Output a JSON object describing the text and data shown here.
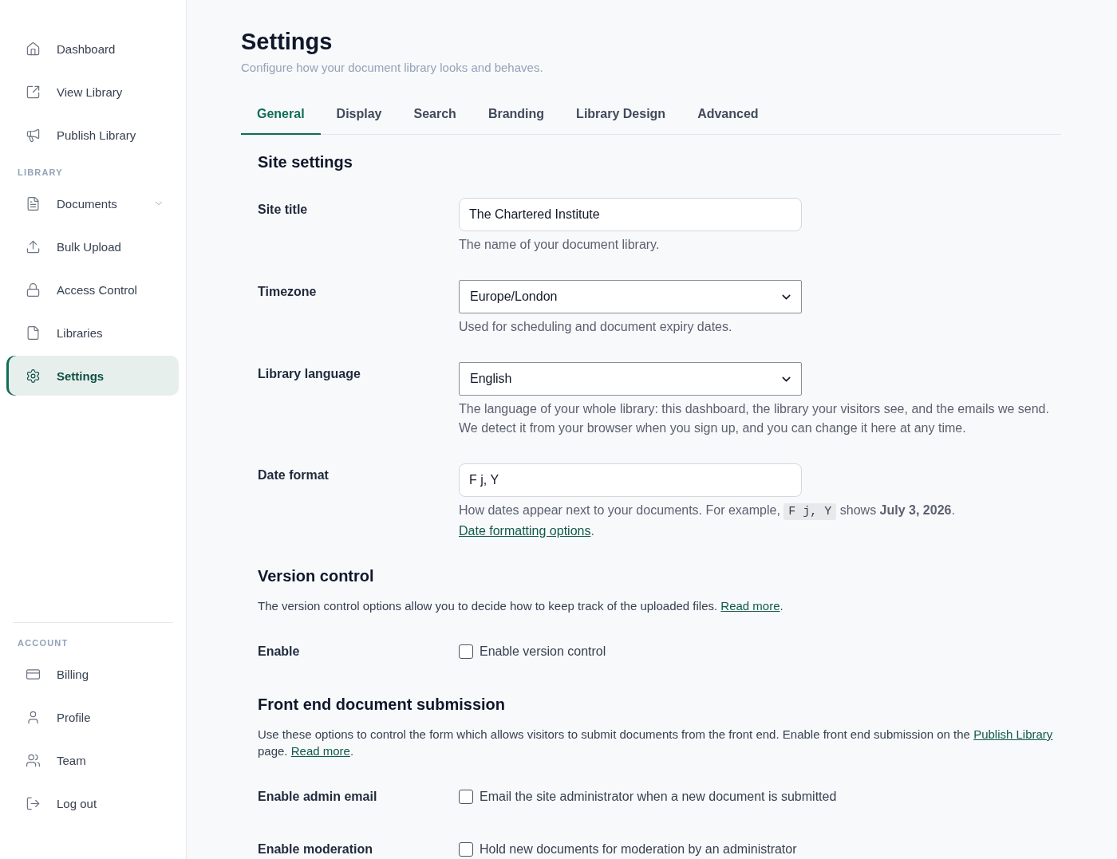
{
  "sidebar": {
    "groups": [
      {
        "items": [
          {
            "kind": "link",
            "label": "Dashboard",
            "selected": false
          },
          {
            "kind": "link",
            "label": "View Library",
            "selected": false
          },
          {
            "kind": "link",
            "label": "Publish Library",
            "selected": false
          }
        ]
      },
      {
        "heading": "LIBRARY",
        "items": [
          {
            "kind": "group",
            "label": "Documents",
            "selected": false,
            "expanded": false
          },
          {
            "kind": "link",
            "label": "Bulk Upload",
            "selected": false
          },
          {
            "kind": "link",
            "label": "Access Control",
            "selected": false
          },
          {
            "kind": "link",
            "label": "Libraries",
            "selected": false
          },
          {
            "kind": "link",
            "label": "Settings",
            "selected": true
          }
        ]
      },
      {
        "heading": "ACCOUNT",
        "items": [
          {
            "kind": "link",
            "label": "Billing",
            "selected": false
          },
          {
            "kind": "link",
            "label": "Profile",
            "selected": false
          },
          {
            "kind": "link",
            "label": "Team",
            "selected": false
          },
          {
            "kind": "link",
            "label": "Log out",
            "selected": false
          }
        ]
      }
    ]
  },
  "page": {
    "title": "Settings",
    "subtitle": "Configure how your document library looks and behaves."
  },
  "tabs": [
    {
      "label": "General",
      "selected": true
    },
    {
      "label": "Display",
      "selected": false
    },
    {
      "label": "Search",
      "selected": false
    },
    {
      "label": "Branding",
      "selected": false
    },
    {
      "label": "Library Design",
      "selected": false
    },
    {
      "label": "Advanced",
      "selected": false
    }
  ],
  "sections": [
    {
      "title": "Site settings",
      "rows": [
        {
          "label": "Site title",
          "field": {
            "kind": "text",
            "value": "The Chartered Institute"
          },
          "help": [
            {
              "kind": "text",
              "text": "The name of your document library."
            }
          ]
        },
        {
          "label": "Timezone",
          "field": {
            "kind": "select",
            "value": "Europe/London"
          },
          "help": [
            {
              "kind": "text",
              "text": "Used for scheduling and document expiry dates."
            }
          ]
        },
        {
          "label": "Library language",
          "field": {
            "kind": "select",
            "value": "English"
          },
          "help": [
            {
              "kind": "text",
              "text": "The language of your whole library: this dashboard, the library your visitors see, and the emails we send. We detect it from your browser when you sign up, and you can change it here at any time."
            }
          ]
        },
        {
          "label": "Date format",
          "field": {
            "kind": "text",
            "value": "F j, Y"
          },
          "help": [
            {
              "kind": "text",
              "text": "How dates appear next to your documents. For example, "
            },
            {
              "kind": "code",
              "text": "F j, Y"
            },
            {
              "kind": "text",
              "text": " shows **July 3, 2026**. "
            },
            {
              "kind": "link",
              "text": "Date formatting options"
            },
            {
              "kind": "text",
              "text": "."
            }
          ]
        }
      ]
    },
    {
      "title": "Version control",
      "intro": [
        {
          "kind": "text",
          "text": "The version control options allow you to decide how to keep track of the uploaded files. "
        },
        {
          "kind": "link",
          "text": "Read more"
        },
        {
          "kind": "text",
          "text": "."
        }
      ],
      "rows": [
        {
          "label": "Enable",
          "field": {
            "kind": "checkbox",
            "checked": false,
            "text": "Enable version control"
          }
        }
      ]
    },
    {
      "title": "Front end document submission",
      "intro": [
        {
          "kind": "text",
          "text": "Use these options to control the form which allows visitors to submit documents from the front end. Enable front end submission on the "
        },
        {
          "kind": "link",
          "text": "Publish Library"
        },
        {
          "kind": "text",
          "text": " page. "
        },
        {
          "kind": "link",
          "text": "Read more"
        },
        {
          "kind": "text",
          "text": "."
        }
      ],
      "rows": [
        {
          "label": "Enable admin email",
          "field": {
            "kind": "checkbox",
            "checked": false,
            "text": "Email the site administrator when a new document is submitted"
          }
        },
        {
          "label": "Enable moderation",
          "field": {
            "kind": "checkbox",
            "checked": false,
            "text": "Hold new documents for moderation by an administrator"
          }
        }
      ]
    }
  ]
}
